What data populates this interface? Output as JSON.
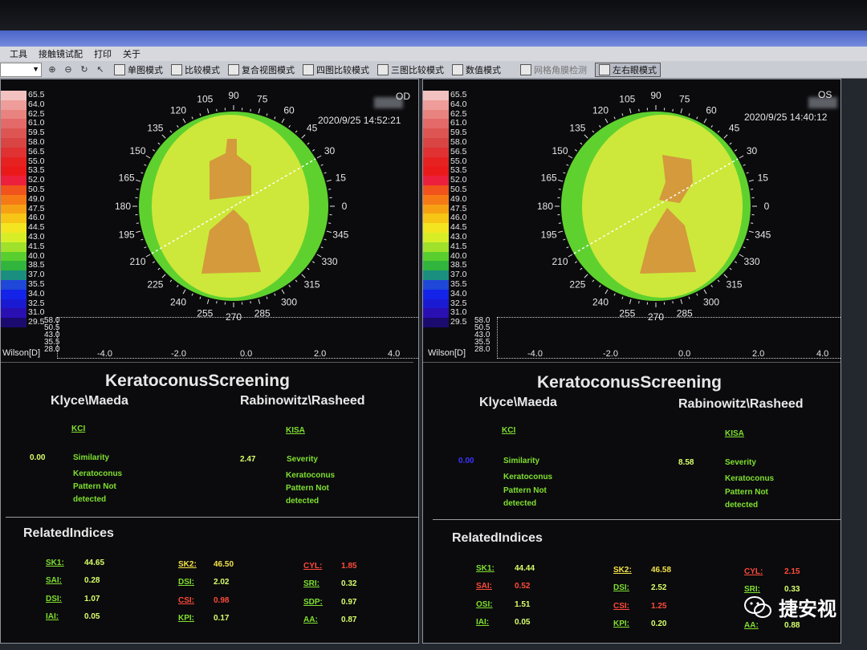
{
  "menu": [
    "工具",
    "接触镜试配",
    "打印",
    "关于"
  ],
  "toolbar": {
    "buttons": [
      "单图模式",
      "比较模式",
      "复合视图模式",
      "四图比较模式",
      "三图比较模式",
      "数值模式",
      "网格角膜检测",
      "左右眼模式"
    ]
  },
  "scale": {
    "labels": [
      "65.5",
      "64.0",
      "62.5",
      "61.0",
      "59.5",
      "58.0",
      "56.5",
      "55.0",
      "53.5",
      "52.0",
      "50.5",
      "49.0",
      "47.5",
      "46.0",
      "44.5",
      "43.0",
      "41.5",
      "40.0",
      "38.5",
      "37.0",
      "35.5",
      "34.0",
      "32.5",
      "31.0",
      "29.5"
    ],
    "colors": [
      "#f3c2c0",
      "#ee9d9a",
      "#e98380",
      "#e36a68",
      "#dd5552",
      "#d84543",
      "#e03133",
      "#e62221",
      "#ea1a1a",
      "#ec1f3c",
      "#f0531b",
      "#f57a16",
      "#f6a014",
      "#f6c515",
      "#f3e520",
      "#d7ee27",
      "#9fe12b",
      "#59cf2f",
      "#31b53d",
      "#1b8f7f",
      "#1f47d8",
      "#1323e8",
      "#1a1ad2",
      "#2a0fb3",
      "#1b0b6e"
    ],
    "unit": "Wilson[D]"
  },
  "graph": {
    "ylabels": [
      "58.0",
      "50.5",
      "43.0",
      "35.5",
      "28.0"
    ],
    "xlabels": [
      "-4.0",
      "-2.0",
      "0.0",
      "2.0",
      "4.0"
    ]
  },
  "angles": [
    "90",
    "75",
    "60",
    "45",
    "30",
    "15",
    "0",
    "345",
    "330",
    "315",
    "300",
    "285",
    "270",
    "255",
    "240",
    "225",
    "210",
    "195",
    "180",
    "165",
    "150",
    "135",
    "120",
    "105"
  ],
  "screening_title": "KeratoconusScreening",
  "related_title": "RelatedIndices",
  "left": {
    "eye": "OD",
    "timestamp": "2020/9/25   14:52:21",
    "klyce_header": "Klyce\\Maeda",
    "rab_header": "Rabinowitz\\Rasheed",
    "kci_label": "KCI",
    "kisa_label": "KISA",
    "similarity_value": "0.00",
    "similarity_label": "Similarity",
    "severity_value": "2.47",
    "severity_label": "Severity",
    "result_line1": "Keratoconus",
    "result_line2": "Pattern Not",
    "result_line3": "detected",
    "indices": [
      {
        "label": "SK1:",
        "value": "44.65"
      },
      {
        "label": "SAI:",
        "value": "0.28"
      },
      {
        "label": "DSI:",
        "value": "1.07"
      },
      {
        "label": "IAI:",
        "value": "0.05"
      },
      {
        "label": "SK2:",
        "value": "46.50"
      },
      {
        "label": "DSI:",
        "value": "2.02"
      },
      {
        "label": "CSI:",
        "value": "0.98"
      },
      {
        "label": "KPI:",
        "value": "0.17"
      },
      {
        "label": "CYL:",
        "value": "1.85"
      },
      {
        "label": "SRI:",
        "value": "0.32"
      },
      {
        "label": "SDP:",
        "value": "0.97"
      },
      {
        "label": "AA:",
        "value": "0.87"
      }
    ]
  },
  "right": {
    "eye": "OS",
    "timestamp": "2020/9/25   14:40:12",
    "klyce_header": "Klyce\\Maeda",
    "rab_header": "Rabinowitz\\Rasheed",
    "kci_label": "KCI",
    "kisa_label": "KISA",
    "similarity_value": "0.00",
    "similarity_label": "Similarity",
    "severity_value": "8.58",
    "severity_label": "Severity",
    "result_line1": "Keratoconus",
    "result_line2": "Pattern Not",
    "result_line3": "detected",
    "indices": [
      {
        "label": "SK1:",
        "value": "44.44"
      },
      {
        "label": "SAI:",
        "value": "0.52"
      },
      {
        "label": "OSI:",
        "value": "1.51"
      },
      {
        "label": "IAI:",
        "value": "0.05"
      },
      {
        "label": "SK2:",
        "value": "46.58"
      },
      {
        "label": "DSI:",
        "value": "2.52"
      },
      {
        "label": "CSI:",
        "value": "1.25"
      },
      {
        "label": "KPI:",
        "value": "0.20"
      },
      {
        "label": "CYL:",
        "value": "2.15"
      },
      {
        "label": "SRI:",
        "value": "0.33"
      },
      {
        "label": "AA:",
        "value": "0.88"
      }
    ]
  },
  "watermark": "捷安视",
  "colors": {
    "map_base": "#cde83a",
    "map_edge": "#5fd12f",
    "map_center": "#d49a3c",
    "label_green": "#7fe030",
    "label_red": "#ff4b3a",
    "label_yellow": "#f2e24a"
  }
}
